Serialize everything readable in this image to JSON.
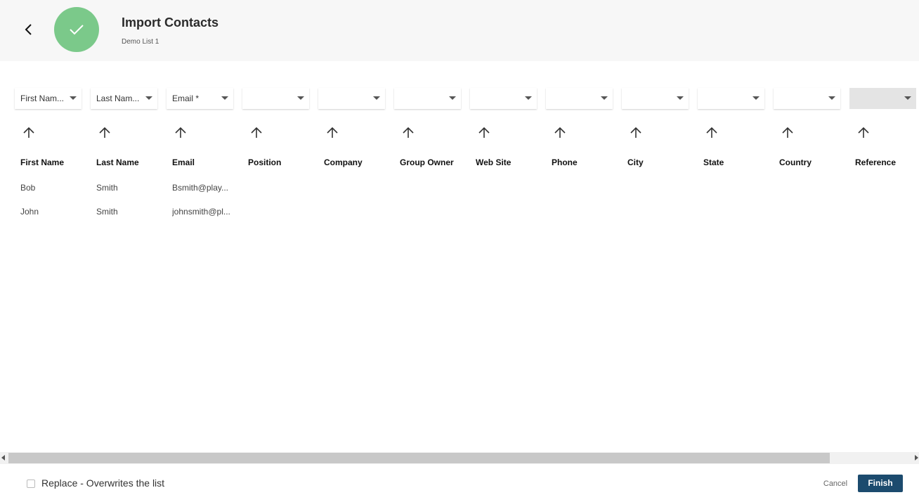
{
  "header": {
    "title": "Import Contacts",
    "subtitle": "Demo List 1"
  },
  "columns": [
    {
      "select": "First Nam...",
      "header": "First Name",
      "rows": [
        "Bob",
        "John"
      ]
    },
    {
      "select": "Last Nam...",
      "header": "Last Name",
      "rows": [
        "Smith",
        "Smith"
      ]
    },
    {
      "select": "Email *",
      "header": "Email",
      "rows": [
        "Bsmith@play...",
        "johnsmith@pl..."
      ]
    },
    {
      "select": "",
      "header": "Position",
      "rows": []
    },
    {
      "select": "",
      "header": "Company",
      "rows": []
    },
    {
      "select": "",
      "header": "Group Owner",
      "rows": []
    },
    {
      "select": "",
      "header": "Web Site",
      "rows": []
    },
    {
      "select": "",
      "header": "Phone",
      "rows": []
    },
    {
      "select": "",
      "header": "City",
      "rows": []
    },
    {
      "select": "",
      "header": "State",
      "rows": []
    },
    {
      "select": "",
      "header": "Country",
      "rows": []
    },
    {
      "select": "",
      "header": "Reference",
      "rows": [],
      "disabled": true
    }
  ],
  "footer": {
    "replace_label": "Replace - Overwrites the list",
    "cancel_label": "Cancel",
    "finish_label": "Finish"
  },
  "colors": {
    "status_green": "#7bc98a",
    "finish_button": "#1c4b6e"
  },
  "icons": {
    "back": "chevron-left-icon",
    "status": "check-icon",
    "sort": "arrow-up-icon",
    "dropdown": "caret-down-icon"
  }
}
